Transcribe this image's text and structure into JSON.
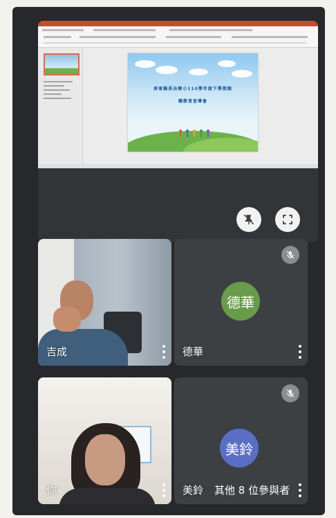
{
  "presentation": {
    "slide": {
      "line1": "屏東縣長治鄉小110學年度下學期親",
      "line2": "職教育宣導會"
    },
    "pin_button": {
      "icon": "unpin-icon"
    },
    "fullscreen_button": {
      "icon": "fullscreen-icon"
    }
  },
  "participants": [
    {
      "name": "吉成",
      "muted": false,
      "has_video": true
    },
    {
      "name": "德華",
      "avatar_text": "德華",
      "avatar_color": "#6a9a4c",
      "muted": true,
      "has_video": false
    },
    {
      "name": "你",
      "muted": false,
      "has_video": true
    },
    {
      "name": "美鈴",
      "avatar_text": "美鈴",
      "avatar_color": "#5a6fc4",
      "muted": true,
      "has_video": false
    }
  ],
  "others_label": "其他 8 位參與者",
  "colors": {
    "background": "#26282b",
    "tile": "#3c4043"
  }
}
